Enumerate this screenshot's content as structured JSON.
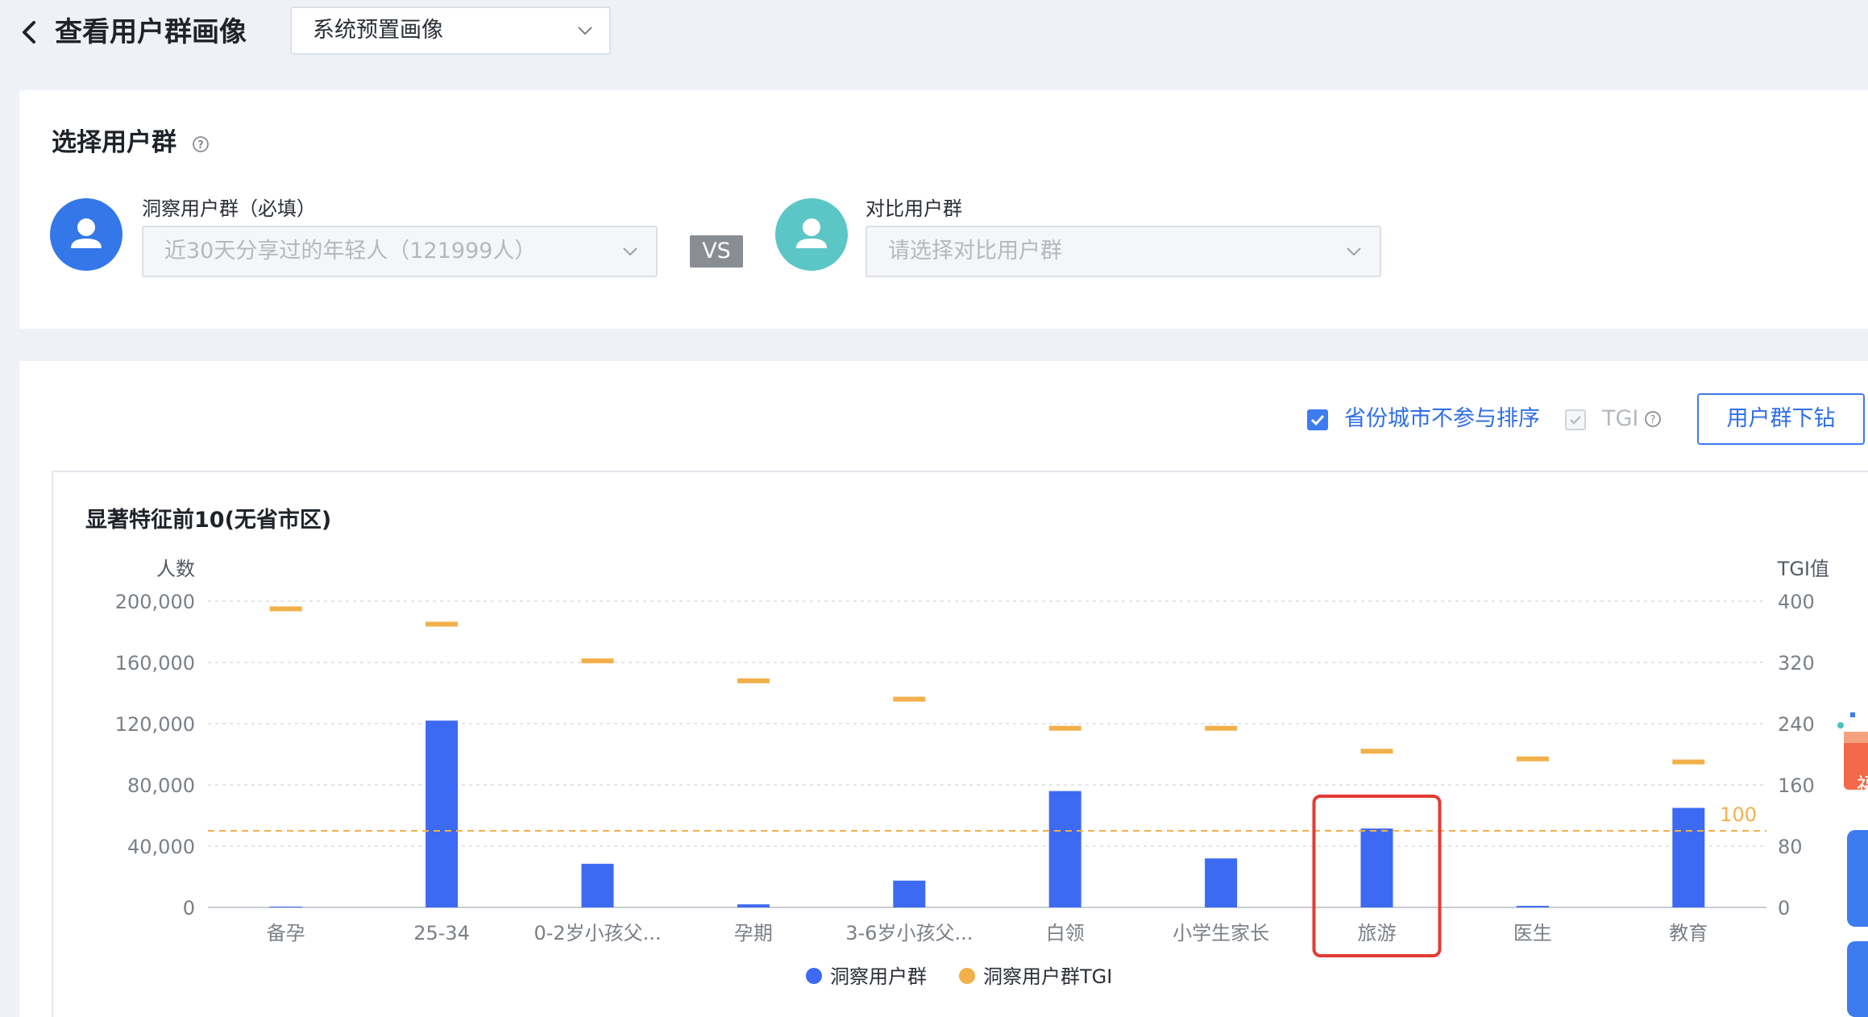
{
  "header": {
    "title": "查看用户群画像",
    "preset_select": "系统预置画像"
  },
  "select_group": {
    "title": "选择用户群",
    "insight": {
      "label": "洞察用户群（必填）",
      "value": "近30天分享过的年轻人（121999人）"
    },
    "vs": "VS",
    "compare": {
      "label": "对比用户群",
      "placeholder": "请选择对比用户群"
    }
  },
  "options": {
    "exclude_city": {
      "label": "省份城市不参与排序",
      "checked": true
    },
    "tgi": {
      "label": "TGI",
      "checked": true,
      "disabled": true
    },
    "drill_button": "用户群下钻"
  },
  "colors": {
    "bar": "#3d6af2",
    "tgi": "#f2b04a",
    "highlight": "#e33b33",
    "accent": "#3d7bf0"
  },
  "chart_data": {
    "type": "bar",
    "title": "显著特征前10(无省市区)",
    "ylabel": "人数",
    "y2label": "TGI值",
    "categories": [
      "备孕",
      "25-34",
      "0-2岁小孩父...",
      "孕期",
      "3-6岁小孩父...",
      "白领",
      "小学生家长",
      "旅游",
      "医生",
      "教育"
    ],
    "ylim": [
      0,
      200000
    ],
    "y2lim": [
      0,
      400
    ],
    "yticks": [
      "200,000",
      "160,000",
      "120,000",
      "80,000",
      "40,000",
      "0"
    ],
    "y2ticks": [
      "400",
      "320",
      "240",
      "160",
      "80",
      "0"
    ],
    "reference_line": {
      "value": 100,
      "label": "100"
    },
    "highlight_category": "旅游",
    "grid": true,
    "legend_position": "bottom",
    "series": [
      {
        "name": "洞察用户群",
        "type": "bar",
        "axis": "left",
        "values": [
          500,
          122000,
          28500,
          2000,
          17500,
          76000,
          32000,
          51500,
          1000,
          65000
        ]
      },
      {
        "name": "洞察用户群TGI",
        "type": "marker",
        "axis": "right",
        "values": [
          390,
          370,
          322,
          296,
          272,
          234,
          234,
          204,
          194,
          190
        ]
      }
    ]
  }
}
